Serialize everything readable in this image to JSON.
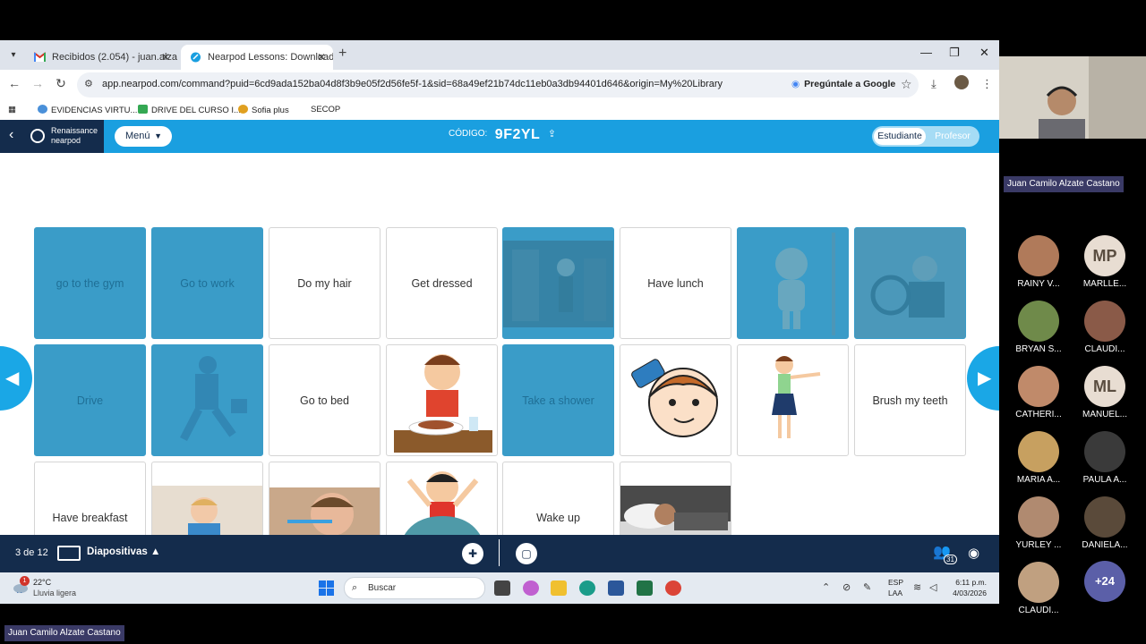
{
  "browser": {
    "tabs": [
      {
        "label": "Recibidos (2.054) - juan.alzateac"
      },
      {
        "label": "Nearpod Lessons: Download re"
      }
    ],
    "url": "app.nearpod.com/command?puid=6cd9ada152ba04d8f3b9e05f2d56fe5f-1&sid=68a49ef21b74dc11eb0a3db94401d646&origin=My%20Library",
    "ask_google": "Pregúntale a Google",
    "bookmarks": [
      "EVIDENCIAS VIRTU...",
      "DRIVE DEL CURSO I...",
      "Sofia plus",
      "SECOP"
    ]
  },
  "nearpod": {
    "brand_line1": "Renaissance",
    "brand_line2": "nearpod",
    "menu_label": "Menú",
    "code_label": "CÓDIGO:",
    "code_value": "9F2YL",
    "toggle_student": "Estudiante",
    "toggle_teacher": "Profesor"
  },
  "cards": [
    {
      "label": "go to the gym",
      "matched": true
    },
    {
      "label": "Go to work",
      "matched": true
    },
    {
      "label": "Do my hair",
      "matched": false
    },
    {
      "label": "Get dressed",
      "matched": false
    },
    {
      "image": "gym-photo",
      "matched": true
    },
    {
      "label": "Have lunch",
      "matched": false
    },
    {
      "image": "shower-cartoon",
      "matched": true
    },
    {
      "image": "driving-photo",
      "matched": true
    },
    {
      "label": "Drive",
      "matched": true
    },
    {
      "image": "businessman-running",
      "matched": true
    },
    {
      "label": "Go to bed",
      "matched": false
    },
    {
      "image": "boy-eating-lunch",
      "matched": false
    },
    {
      "label": "Take a shower",
      "matched": true
    },
    {
      "image": "boy-combing-hair",
      "matched": false
    },
    {
      "image": "girl-dressed",
      "matched": false
    },
    {
      "label": "Brush my teeth",
      "matched": false
    },
    {
      "label": "Have breakfast",
      "matched": false
    },
    {
      "image": "boy-eating-breakfast",
      "matched": false
    },
    {
      "image": "boy-brushing-teeth",
      "matched": false
    },
    {
      "image": "boy-waking-up",
      "matched": false
    },
    {
      "label": "Wake up",
      "matched": false
    },
    {
      "image": "man-sleeping",
      "matched": false
    }
  ],
  "footer": {
    "slide_counter": "3 de 12",
    "slides_label": "Diapositivas",
    "students_count": "31"
  },
  "taskbar": {
    "temperature": "22°C",
    "weather": "Lluvia ligera",
    "weather_badge": "1",
    "search_placeholder": "Buscar",
    "lang1": "ESP",
    "lang2": "LAA",
    "time": "6:11 p.m.",
    "date": "4/03/2026"
  },
  "call": {
    "presenter": "Juan Camilo Alzate Castano",
    "participants": [
      {
        "name": "RAINY V...",
        "avatar_color": "#b07a5a"
      },
      {
        "name": "MARLLE...",
        "initials": "MP"
      },
      {
        "name": "BRYAN S...",
        "avatar_color": "#6f8a4a"
      },
      {
        "name": "CLAUDI...",
        "avatar_color": "#8a5a48"
      },
      {
        "name": "CATHERI...",
        "avatar_color": "#c08a6a"
      },
      {
        "name": "MANUEL...",
        "initials": "ML"
      },
      {
        "name": "MARIA A...",
        "avatar_color": "#c7a060"
      },
      {
        "name": "PAULA A...",
        "avatar_color": "#3a3a3a"
      },
      {
        "name": "YURLEY ...",
        "avatar_color": "#b08a70"
      },
      {
        "name": "DANIELA...",
        "avatar_color": "#5a4a3a"
      },
      {
        "name": "CLAUDI...",
        "avatar_color": "#c0a080"
      }
    ],
    "more_count": "+24"
  },
  "colors": {
    "nearpod_blue": "#1a9fe0",
    "nearpod_navy": "#142c4c",
    "matched_card": "#3a9cc8"
  }
}
